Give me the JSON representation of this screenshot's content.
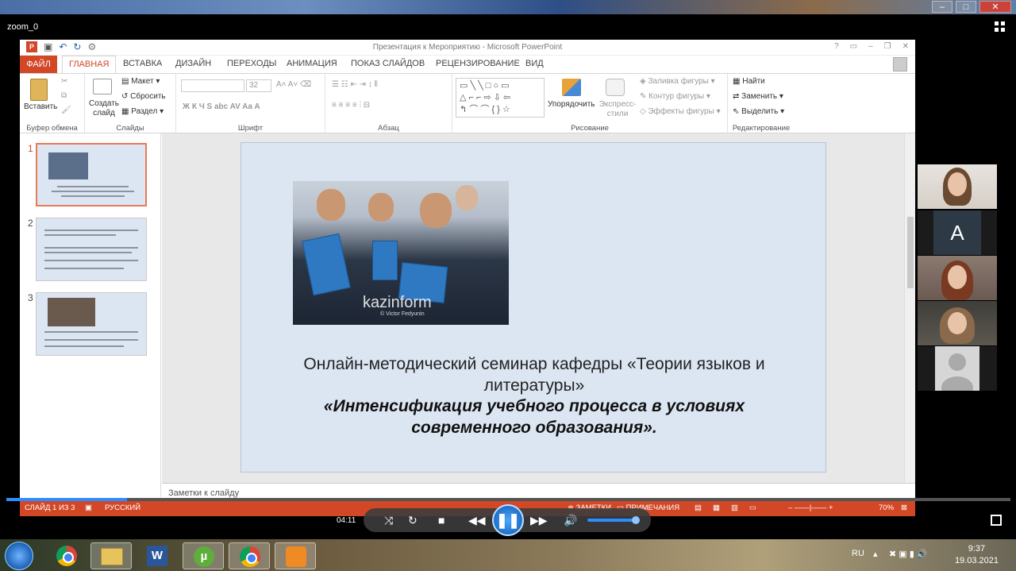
{
  "zoom": {
    "window_title": "zoom_0",
    "time": "04:11",
    "progress": 0.12
  },
  "ppt": {
    "doc_title": "Презентация к Мероприятию - Microsoft PowerPoint",
    "tabs": [
      "ФАЙЛ",
      "ГЛАВНАЯ",
      "ВСТАВКА",
      "ДИЗАЙН",
      "ПЕРЕХОДЫ",
      "АНИМАЦИЯ",
      "ПОКАЗ СЛАЙДОВ",
      "РЕЦЕНЗИРОВАНИЕ",
      "ВИД"
    ],
    "ribbon": {
      "paste": "Вставить",
      "new_slide": "Создать слайд",
      "layout": "Макет",
      "reset": "Сбросить",
      "section": "Раздел",
      "font_size": "32",
      "arrange": "Упорядочить",
      "quick_styles": "Экспресс-стили",
      "shape_fill": "Заливка фигуры",
      "shape_outline": "Контур фигуры",
      "shape_effects": "Эффекты фигуры",
      "find": "Найти",
      "replace": "Заменить",
      "select": "Выделить",
      "groups": {
        "clipboard": "Буфер обмена",
        "slides": "Слайды",
        "font": "Шрифт",
        "paragraph": "Абзац",
        "drawing": "Рисование",
        "editing": "Редактирование"
      }
    },
    "thumbnails": [
      "1",
      "2",
      "3"
    ],
    "slide": {
      "watermark": "kazinform",
      "watermark_sub": "© Victor Fedyunin",
      "line1": "Онлайн-методический семинар кафедры «Теории языков и литературы»",
      "line2": "«Интенсификация учебного процесса в условиях современного образования»."
    },
    "notes_placeholder": "Заметки к слайду",
    "status": {
      "slide": "СЛАЙД 1 ИЗ 3",
      "lang": "РУССКИЙ",
      "notes": "ЗАМЕТКИ",
      "comments": "ПРИМЕЧАНИЯ",
      "zoom": "70%"
    }
  },
  "participants": {
    "avatar_letter": "A"
  },
  "taskbar": {
    "lang": "RU",
    "time": "9:37",
    "date": "19.03.2021"
  },
  "colors": {
    "ppt_accent": "#d24726",
    "zoom_blue": "#2d8cff"
  }
}
